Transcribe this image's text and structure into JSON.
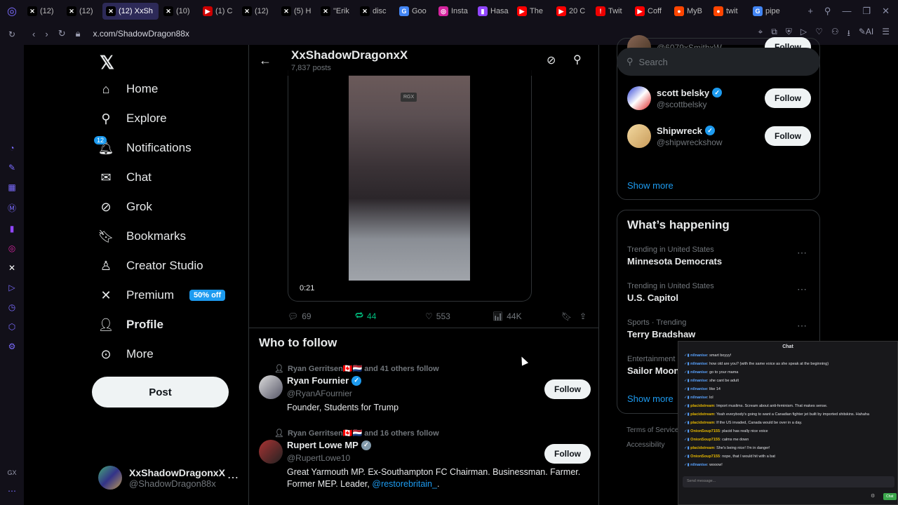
{
  "browser": {
    "tabs": [
      {
        "label": "(12)",
        "fav": "✕",
        "color": "#000"
      },
      {
        "label": "(12)",
        "fav": "✕",
        "color": "#000"
      },
      {
        "label": "(12) XxSh",
        "fav": "✕",
        "color": "#000",
        "active": true
      },
      {
        "label": "(10)",
        "fav": "✕",
        "color": "#000"
      },
      {
        "label": "(1) C",
        "fav": "▶",
        "color": "#c00"
      },
      {
        "label": "(12)",
        "fav": "✕",
        "color": "#000"
      },
      {
        "label": "(5) H",
        "fav": "✕",
        "color": "#000"
      },
      {
        "label": "\"Erik",
        "fav": "✕",
        "color": "#000"
      },
      {
        "label": "disc",
        "fav": "✕",
        "color": "#000"
      },
      {
        "label": "Goo",
        "fav": "G",
        "color": "#4285f4"
      },
      {
        "label": "Insta",
        "fav": "◎",
        "color": "#d6249f"
      },
      {
        "label": "Hasa",
        "fav": "▮",
        "color": "#9146ff"
      },
      {
        "label": "The",
        "fav": "▶",
        "color": "#f00"
      },
      {
        "label": "20 C",
        "fav": "▶",
        "color": "#f00"
      },
      {
        "label": "Twit",
        "fav": "!",
        "color": "#e00"
      },
      {
        "label": "Coff",
        "fav": "▶",
        "color": "#f00"
      },
      {
        "label": "MyB",
        "fav": "●",
        "color": "#ff4500"
      },
      {
        "label": "twit",
        "fav": "●",
        "color": "#ff4500"
      },
      {
        "label": "pipe",
        "fav": "G",
        "color": "#4285f4"
      }
    ],
    "url": "x.com/ShadowDragon88x",
    "ai_label": "AI"
  },
  "nav": {
    "items": [
      {
        "label": "Home",
        "icon": "home-icon",
        "glyph": "⌂"
      },
      {
        "label": "Explore",
        "icon": "search-icon",
        "glyph": "⚲"
      },
      {
        "label": "Notifications",
        "icon": "bell-icon",
        "glyph": "🔔︎"
      },
      {
        "label": "Chat",
        "icon": "mail-icon",
        "glyph": "✉"
      },
      {
        "label": "Grok",
        "icon": "grok-icon",
        "glyph": "⊘"
      },
      {
        "label": "Bookmarks",
        "icon": "bookmark-icon",
        "glyph": "🔖︎"
      },
      {
        "label": "Creator Studio",
        "icon": "creator-studio-icon",
        "glyph": "♙"
      },
      {
        "label": "Premium",
        "icon": "x-premium-icon",
        "glyph": "✕"
      },
      {
        "label": "Profile",
        "icon": "profile-icon",
        "glyph": "👤︎"
      },
      {
        "label": "More",
        "icon": "more-icon",
        "glyph": "⊙"
      }
    ],
    "notif_count": "12",
    "premium_badge": "50% off",
    "post_label": "Post",
    "account": {
      "name": "XxShadowDragonxX",
      "handle": "@ShadowDragon88x"
    }
  },
  "profile_header": {
    "name": "XxShadowDragonxX",
    "posts": "7,837 posts"
  },
  "video": {
    "watermark": "RGX",
    "duration": "0:21"
  },
  "post_actions": {
    "replies": "69",
    "reposts": "44",
    "likes": "553",
    "views": "44K"
  },
  "who_to_follow": {
    "title": "Who to follow",
    "follow_label": "Follow",
    "people": [
      {
        "social": "Ryan Gerritsen🇨🇦🇳🇱 and 41 others follow",
        "name": "Ryan Fournier",
        "handle": "@RyanAFournier",
        "bio": "Founder, Students for Trump",
        "verified": "blue"
      },
      {
        "social": "Ryan Gerritsen🇨🇦🇳🇱 and 16 others follow",
        "name": "Rupert Lowe MP",
        "handle": "@RupertLowe10",
        "bio": "Great Yarmouth MP. Ex-Southampton FC Chairman. Businessman. Farmer. Former MEP. Leader,",
        "bio_link": "@restorebritain_",
        "bio_end": ".",
        "verified": "gray"
      }
    ]
  },
  "right": {
    "search_placeholder": "Search",
    "suggestions": [
      {
        "name": "",
        "handle": "@6079xSmithxW"
      },
      {
        "name": "scott belsky",
        "handle": "@scottbelsky"
      },
      {
        "name": "Shipwreck",
        "handle": "@shipwreckshow"
      }
    ],
    "follow_label": "Follow",
    "show_more": "Show more",
    "happening_title": "What’s happening",
    "trends": [
      {
        "context": "Trending in United States",
        "name": "Minnesota Democrats"
      },
      {
        "context": "Trending in United States",
        "name": "U.S. Capitol"
      },
      {
        "context": "Sports · Trending",
        "name": "Terry Bradshaw"
      },
      {
        "context": "Entertainment",
        "name": "Sailor Moon"
      }
    ],
    "show_more_2": "Show more",
    "footer": [
      "Terms of Service",
      "Accessibility"
    ]
  },
  "chat": {
    "title": "Chat",
    "messages": [
      {
        "user": "nilnanise",
        "text": "smart boyyy!",
        "yellow": false
      },
      {
        "user": "nilnanise",
        "text": "how old are you? (with the same voice as she speak at the beginning)",
        "yellow": false
      },
      {
        "user": "nilnanise",
        "text": "go to your mama",
        "yellow": false
      },
      {
        "user": "nilnanise",
        "text": "she cant be adult",
        "yellow": false
      },
      {
        "user": "nilnanise",
        "text": "like 14",
        "yellow": false
      },
      {
        "user": "nilnanise",
        "text": "lol",
        "yellow": false
      },
      {
        "user": "placidstream",
        "text": "Import muslims. Scream about anti-feminism. That makes sense.",
        "yellow": true
      },
      {
        "user": "placidstream",
        "text": "Yeah everybody's going to want a Canadian fighter jet built by imported shitskins. Hahaha",
        "yellow": true
      },
      {
        "user": "placidstream",
        "text": "If the US invaded, Canada would be over in a day.",
        "yellow": true
      },
      {
        "user": "OnionSoup7155",
        "text": "placid has really nice voice",
        "yellow": true
      },
      {
        "user": "OnionSoup7155",
        "text": "calms me down",
        "yellow": true
      },
      {
        "user": "placidstream",
        "text": "She's being nice! I'm in danger!",
        "yellow": true
      },
      {
        "user": "OnionSoup7155",
        "text": "nope, that I would hit with a bat",
        "yellow": true
      },
      {
        "user": "nilnanise",
        "text": "wooow!",
        "yellow": false
      }
    ],
    "input_placeholder": "Send message...",
    "send_label": "Chat"
  }
}
